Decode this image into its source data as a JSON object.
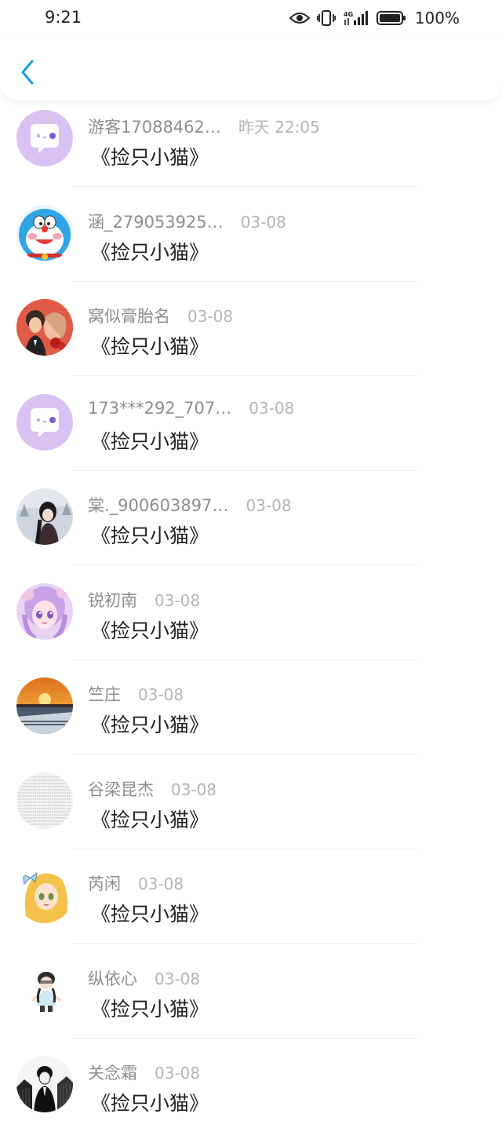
{
  "status_bar": {
    "time": "9:21",
    "network": "4G",
    "battery": "100%"
  },
  "nav": {
    "back_icon": "chevron-left-icon",
    "accent_color": "#1a9be6"
  },
  "messages": [
    {
      "name": "游客17088462…",
      "time": "昨天 22:05",
      "text": "《捡只小猫》",
      "avatar": "default-chat-avatar"
    },
    {
      "name": "涵_279053925…",
      "time": "03-08",
      "text": "《捡只小猫》",
      "avatar": "doraemon-avatar"
    },
    {
      "name": "窝似膏胎名",
      "time": "03-08",
      "text": "《捡只小猫》",
      "avatar": "couple-avatar"
    },
    {
      "name": "173***292_707…",
      "time": "03-08",
      "text": "《捡只小猫》",
      "avatar": "default-chat-avatar"
    },
    {
      "name": "棠._900603897…",
      "time": "03-08",
      "text": "《捡只小猫》",
      "avatar": "girl-snow-avatar"
    },
    {
      "name": "锐初南",
      "time": "03-08",
      "text": "《捡只小猫》",
      "avatar": "anime-girl-avatar"
    },
    {
      "name": "竺庄",
      "time": "03-08",
      "text": "《捡只小猫》",
      "avatar": "sunset-avatar"
    },
    {
      "name": "谷梁昆杰",
      "time": "03-08",
      "text": "《捡只小猫》",
      "avatar": "text-pattern-avatar"
    },
    {
      "name": "芮闲",
      "time": "03-08",
      "text": "《捡只小猫》",
      "avatar": "blonde-anime-avatar"
    },
    {
      "name": "纵依心",
      "time": "03-08",
      "text": "《捡只小猫》",
      "avatar": "cartoon-girl-avatar"
    },
    {
      "name": "关念霜",
      "time": "03-08",
      "text": "《捡只小猫》",
      "avatar": "bw-sketch-avatar"
    }
  ]
}
